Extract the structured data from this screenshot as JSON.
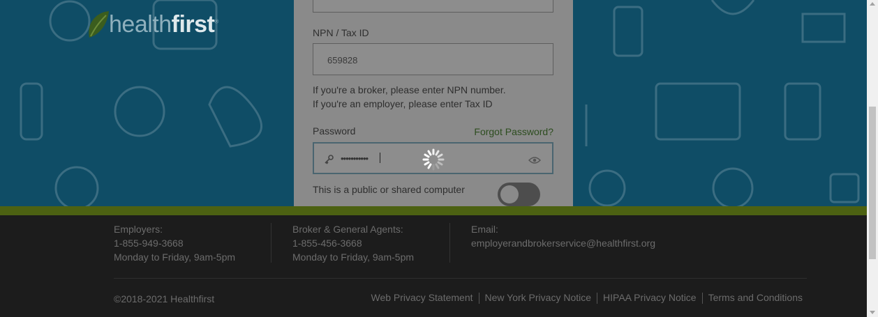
{
  "brand": {
    "logo_part1": "health",
    "logo_part2": "first"
  },
  "login": {
    "npn_label": "NPN / Tax ID",
    "npn_value": "659828",
    "hint_line1": "If you're a broker, please enter NPN number.",
    "hint_line2": "If you're an employer, please enter Tax ID",
    "password_label": "Password",
    "forgot_link": "Forgot Password?",
    "password_value": "•••••••••••",
    "public_computer_label": "This is a public or shared computer"
  },
  "footer": {
    "employers": {
      "title": "Employers:",
      "phone": "1-855-949-3668",
      "hours": "Monday to Friday, 9am-5pm"
    },
    "brokers": {
      "title": "Broker & General Agents:",
      "phone": "1-855-456-3668",
      "hours": "Monday to Friday, 9am-5pm"
    },
    "email": {
      "title": "Email:",
      "address": "employerandbrokerservice@healthfirst.org"
    },
    "copyright": "©2018-2021 Healthfirst",
    "links": [
      "Web Privacy Statement",
      "New York Privacy Notice",
      "HIPAA Privacy Notice",
      "Terms and Conditions"
    ]
  },
  "colors": {
    "hero": "#0f4d66",
    "panel": "#8a8a8a",
    "accent_green": "#4c6112",
    "footer": "#1c1c1c"
  }
}
